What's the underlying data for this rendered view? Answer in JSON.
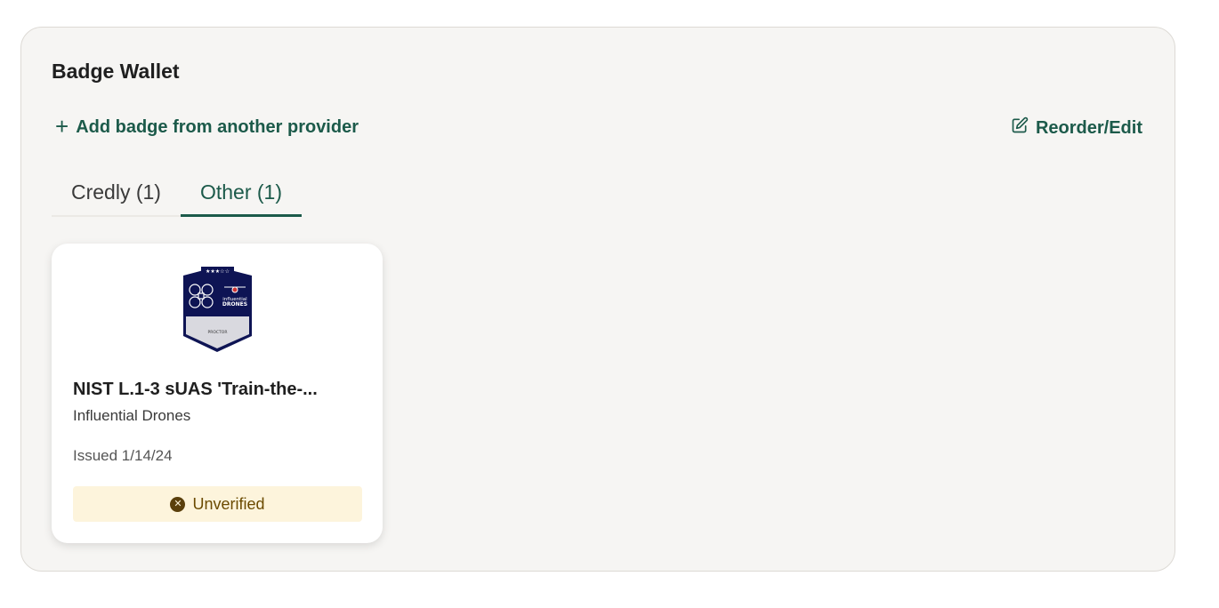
{
  "wallet": {
    "title": "Badge Wallet",
    "add_label": "Add badge from another provider",
    "edit_label": "Reorder/Edit"
  },
  "tabs": [
    {
      "label": "Credly (1)",
      "active": false
    },
    {
      "label": "Other (1)",
      "active": true
    }
  ],
  "badges": [
    {
      "name": "NIST L.1-3 sUAS 'Train-the-...",
      "issuer": "Influential Drones",
      "issued": "Issued 1/14/24",
      "status": "Unverified",
      "image": {
        "stars": "★★★☆☆",
        "brand_line1": "influential",
        "brand_line2": "DRONES",
        "role": "PROCTOR"
      }
    }
  ],
  "colors": {
    "accent": "#1c5a4a",
    "panel_bg": "#f6f5f3",
    "status_bg": "#fdf4dc",
    "status_text": "#6b4a00",
    "badge_navy": "#0e1454"
  },
  "icons": {
    "add": "plus-icon",
    "edit": "edit-icon",
    "status": "close-circle-icon"
  }
}
